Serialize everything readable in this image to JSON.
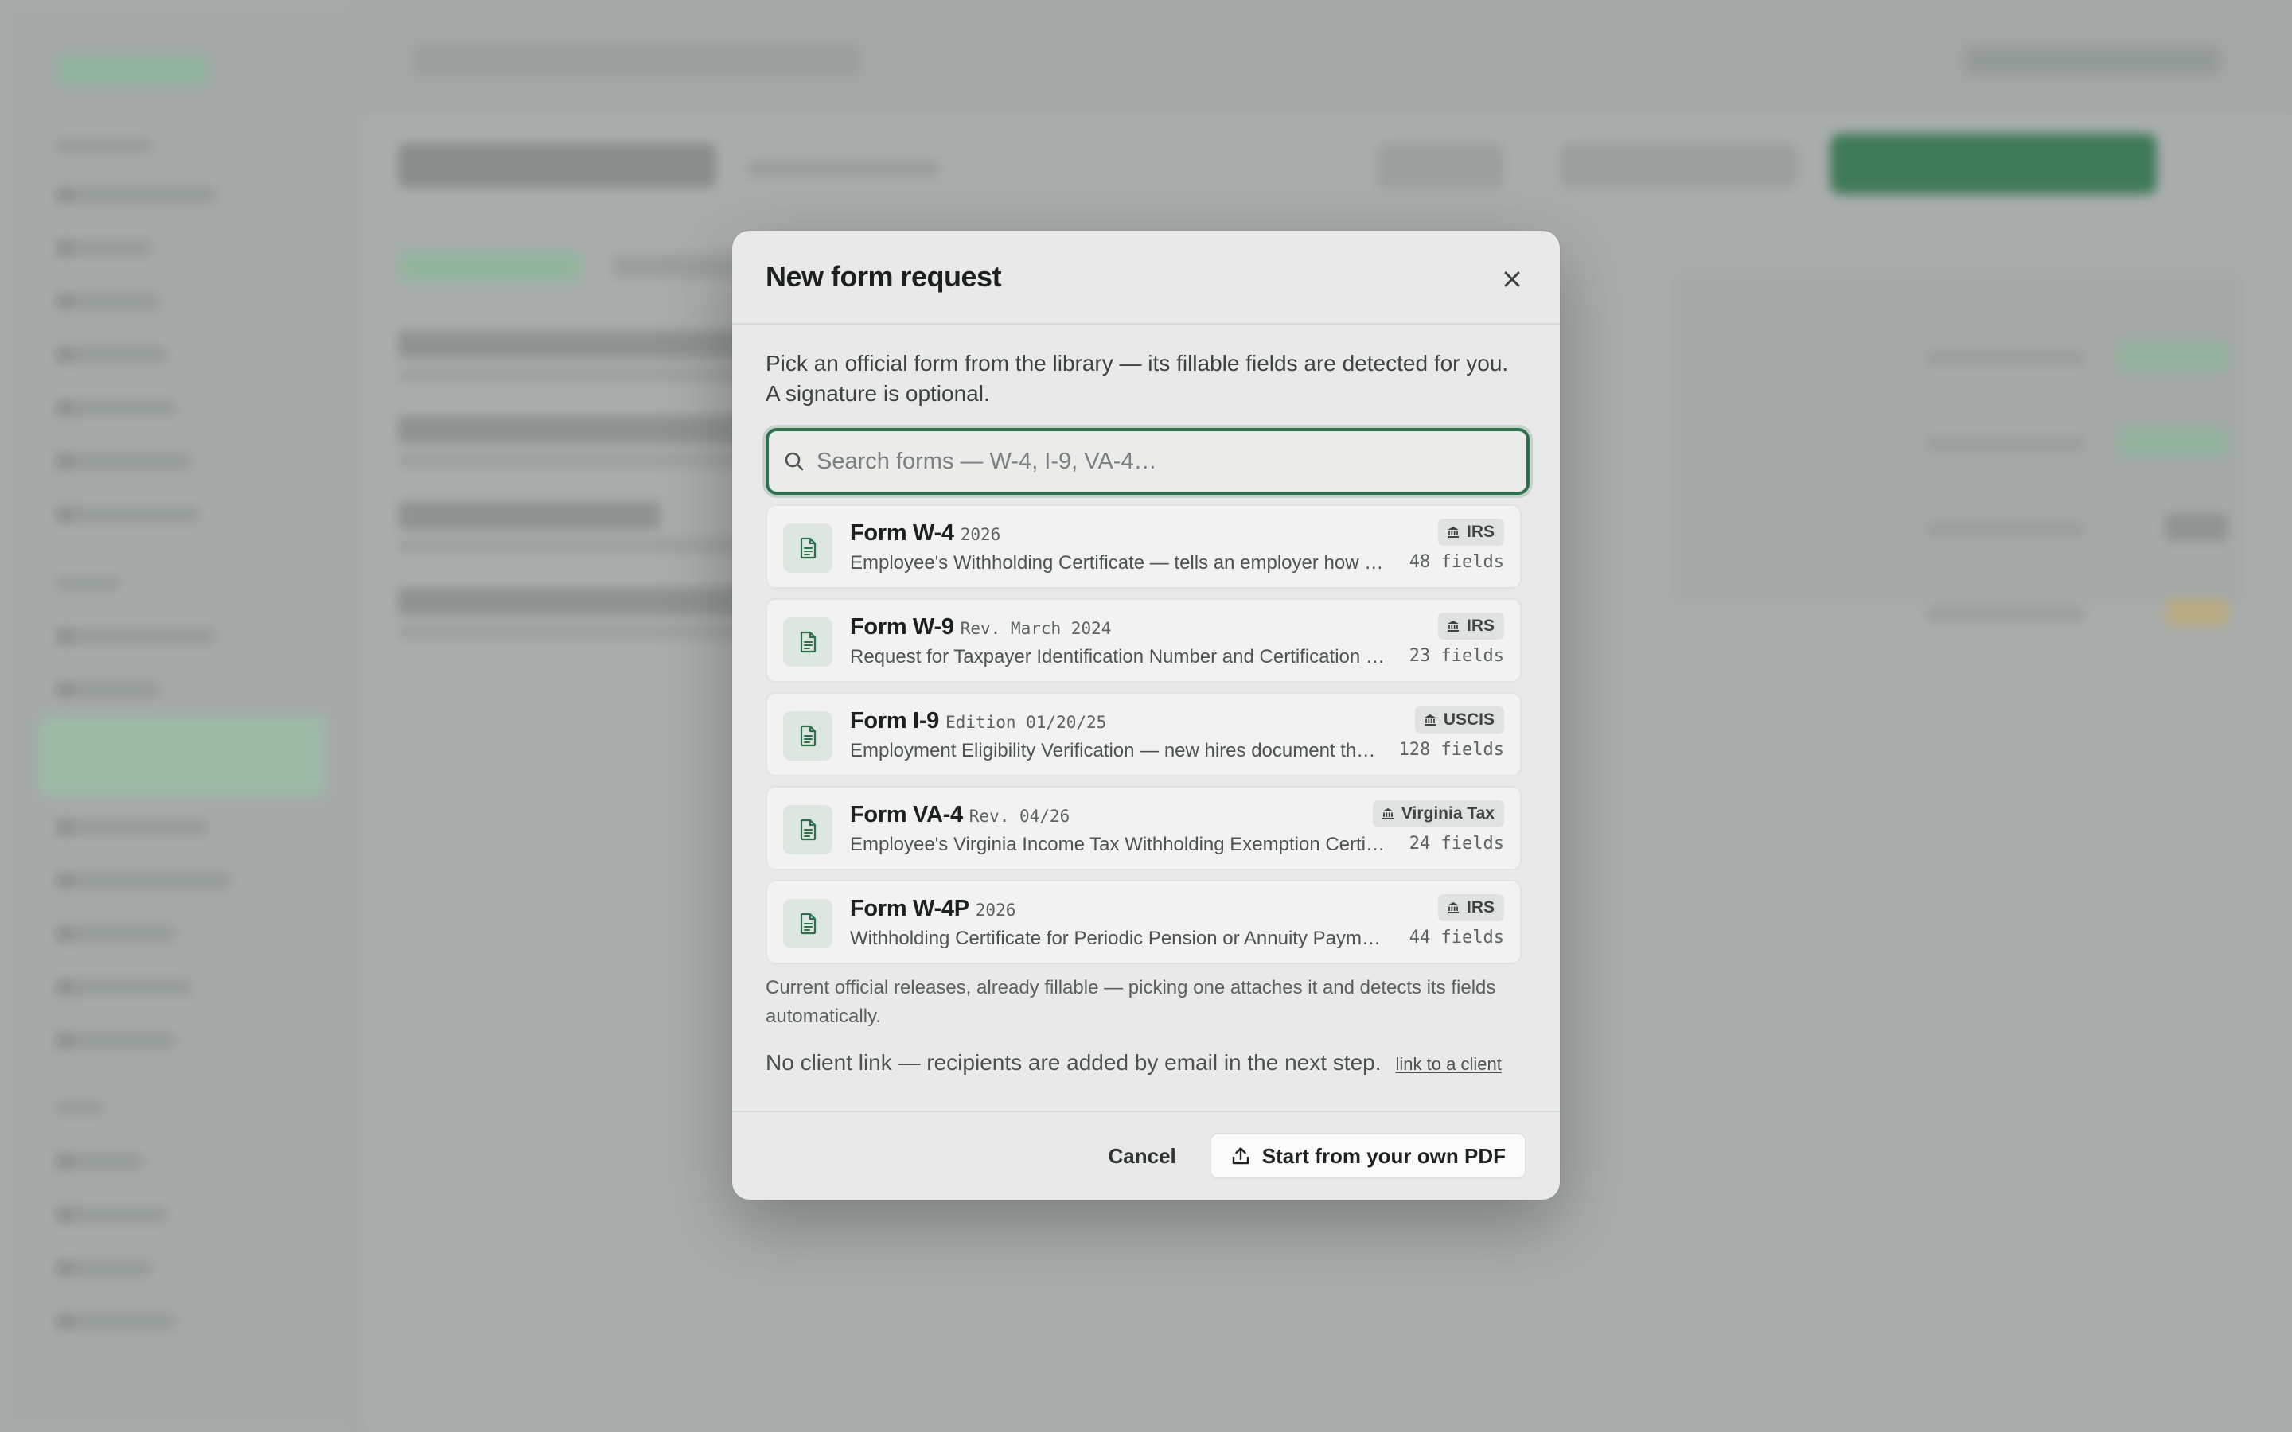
{
  "modal": {
    "title": "New form request",
    "intro": "Pick an official form from the library — its fillable fields are detected for you. A signature is optional.",
    "search_placeholder": "Search forms — W-4, I-9, VA-4…",
    "forms": [
      {
        "name": "Form W-4",
        "edition": "2026",
        "description": "Employee's Withholding Certificate — tells an employer how much federal income tax to withhold",
        "agency": "IRS",
        "fields": "48 fields"
      },
      {
        "name": "Form W-9",
        "edition": "Rev. March 2024",
        "description": "Request for Taxpayer Identification Number and Certification — used to collect TINs",
        "agency": "IRS",
        "fields": "23 fields"
      },
      {
        "name": "Form I-9",
        "edition": "Edition 01/20/25",
        "description": "Employment Eligibility Verification — new hires document their identity and eligibility",
        "agency": "USCIS",
        "fields": "128 fields"
      },
      {
        "name": "Form VA-4",
        "edition": "Rev. 04/26",
        "description": "Employee's Virginia Income Tax Withholding Exemption Certificate",
        "agency": "Virginia Tax",
        "fields": "24 fields"
      },
      {
        "name": "Form W-4P",
        "edition": "2026",
        "description": "Withholding Certificate for Periodic Pension or Annuity Payments",
        "agency": "IRS",
        "fields": "44 fields"
      }
    ],
    "note": "Current official releases, already fillable — picking one attaches it and detects its fields automatically.",
    "client_text": "No client link — recipients are added by email in the next step.",
    "client_link": "link to a client",
    "cancel_label": "Cancel",
    "pdf_label": "Start from your own PDF"
  },
  "icons": {
    "close": "close-icon",
    "search": "search-icon",
    "document": "document-icon",
    "agency": "bank-icon",
    "upload": "upload-icon"
  },
  "colors": {
    "accent": "#2f6f4e",
    "icon_tile": "#dde7e0",
    "modal_bg": "#e8e9e8"
  }
}
